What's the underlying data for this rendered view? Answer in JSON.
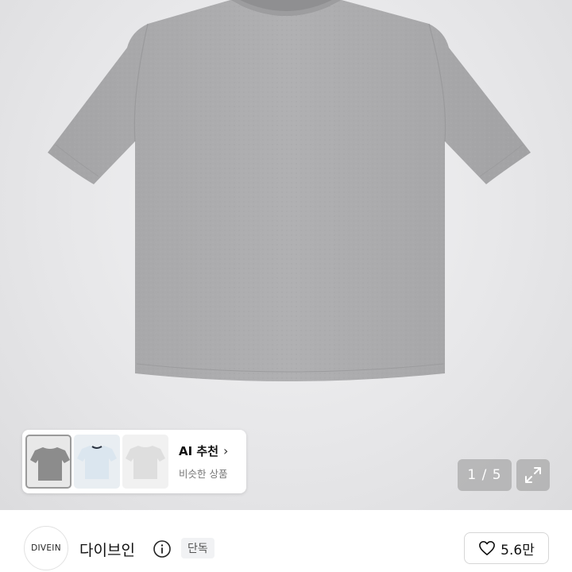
{
  "gallery": {
    "image_description_icon": "gray-tshirt-product-image",
    "pager": {
      "current": "1",
      "separator": "/",
      "total": "5",
      "label": "1 / 5"
    },
    "expand_icon": "expand-icon"
  },
  "recommendation": {
    "title": "AI 추천",
    "subtitle": "비슷한 상품",
    "chevron": "›",
    "thumbnails": [
      {
        "icon": "gray-tshirt-thumbnail",
        "selected": true
      },
      {
        "icon": "light-blue-tshirt-thumbnail",
        "selected": false
      },
      {
        "icon": "white-tshirt-thumbnail",
        "selected": false
      }
    ]
  },
  "seller": {
    "logo_text": "DIVEIN",
    "name": "다이브인",
    "info_icon": "info-icon",
    "badge": "단독",
    "like_count": "5.6만",
    "heart_icon": "heart-icon"
  },
  "colors": {
    "shirt": "#a9a9ab",
    "background": "#e4e4e6",
    "pager_bg": "#969696"
  }
}
